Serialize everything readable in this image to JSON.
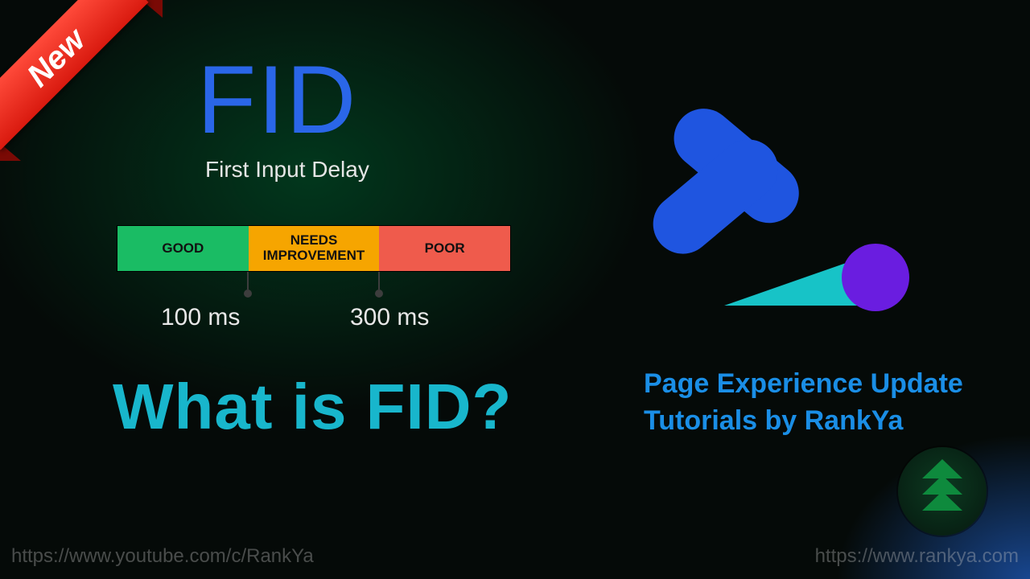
{
  "ribbon": {
    "label": "New"
  },
  "metric": {
    "acronym": "FID",
    "full_name": "First Input Delay",
    "segments": {
      "good": "GOOD",
      "needs_line1": "NEEDS",
      "needs_line2": "IMPROVEMENT",
      "poor": "POOR"
    },
    "thresholds": {
      "t1": "100 ms",
      "t2": "300 ms"
    },
    "colors": {
      "good": "#1abc64",
      "needs": "#f6a500",
      "poor": "#ef5b4c"
    }
  },
  "headline": "What is FID?",
  "series": {
    "line1": "Page Experience Update",
    "line2": "Tutorials by RankYa"
  },
  "footer": {
    "left_url": "https://www.youtube.com/c/RankYa",
    "right_url": "https://www.rankya.com"
  },
  "logo_colors": {
    "chevron": "#1f55e0",
    "wedge": "#17c3c7",
    "dot": "#6a1de0"
  },
  "badge_arrow_color": "#0e8a3d"
}
